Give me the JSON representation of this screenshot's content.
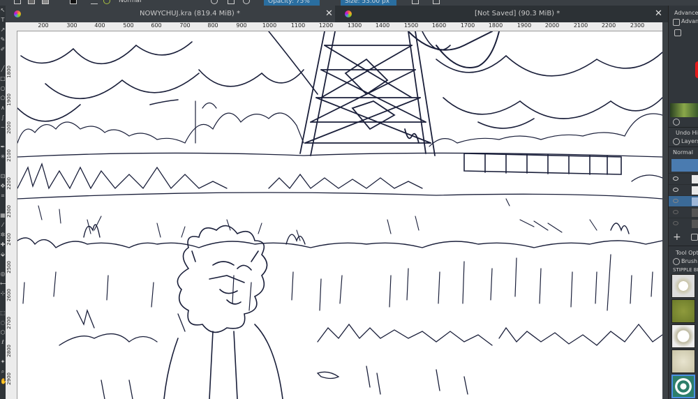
{
  "toolbar": {
    "blend_mode": "Normal",
    "opacity_label": "Opacity: 75%",
    "size_label": "Size: 53.00 px"
  },
  "tabs": [
    {
      "title": "NOWYCHUJ.kra (819.4 MiB) *",
      "close": "✕"
    },
    {
      "title": "[Not Saved]  (90.3 MiB) *",
      "close": "✕"
    }
  ],
  "ruler_h": [
    "200",
    "300",
    "400",
    "500",
    "600",
    "700",
    "800",
    "900",
    "1000",
    "1100",
    "1200",
    "1300",
    "1400",
    "1500",
    "1600",
    "1700",
    "1800",
    "1900",
    "2000",
    "2100",
    "2200",
    "2300"
  ],
  "ruler_v": [
    "1800",
    "1900",
    "2000",
    "2100",
    "2200",
    "2300",
    "2400",
    "2500",
    "2600",
    "2700",
    "2800",
    "2900",
    "3000"
  ],
  "dock": {
    "advanced_1": "Advanced",
    "advanced_2": "Advanced",
    "undo_history": "Undo Hist",
    "layers": "Layers",
    "layer_blend": "Normal",
    "tool_options": "Tool Optio",
    "brush_presets": "Brush Pr",
    "brush_tag": "STIPPLE BEA"
  },
  "colors": {
    "accent": "#2a6ea0",
    "panel_bg": "#31363b",
    "canvas_bg": "#ffffff",
    "ink": "#1a1f3a"
  }
}
